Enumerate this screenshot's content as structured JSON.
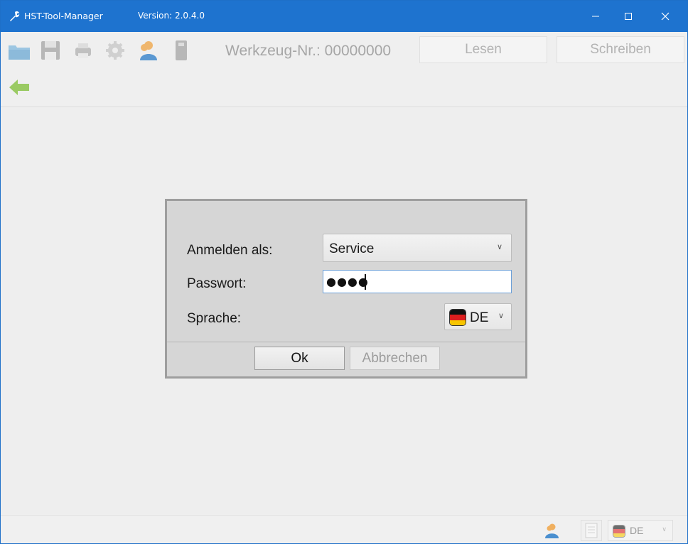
{
  "window": {
    "title": "HST-Tool-Manager",
    "version": "Version: 2.0.4.0",
    "accent": "#1e73cf"
  },
  "toolbar": {
    "icons": [
      "folder-open-icon",
      "save-icon",
      "print-icon",
      "settings-gear-icon",
      "user-icon",
      "usb-stick-icon"
    ],
    "tool_number_label": "Werkzeug-Nr.: 00000000",
    "read_label": "Lesen",
    "write_label": "Schreiben"
  },
  "nav": {
    "back_icon": "back-arrow-icon"
  },
  "login_dialog": {
    "user_label": "Anmelden als:",
    "user_value": "Service",
    "password_label": "Passwort:",
    "password_value": "●●●●",
    "language_label": "Sprache:",
    "language_value": "DE",
    "ok_label": "Ok",
    "cancel_label": "Abbrechen"
  },
  "statusbar": {
    "user_icon": "user-icon",
    "doc_icon": "document-icon",
    "language_value": "DE"
  }
}
